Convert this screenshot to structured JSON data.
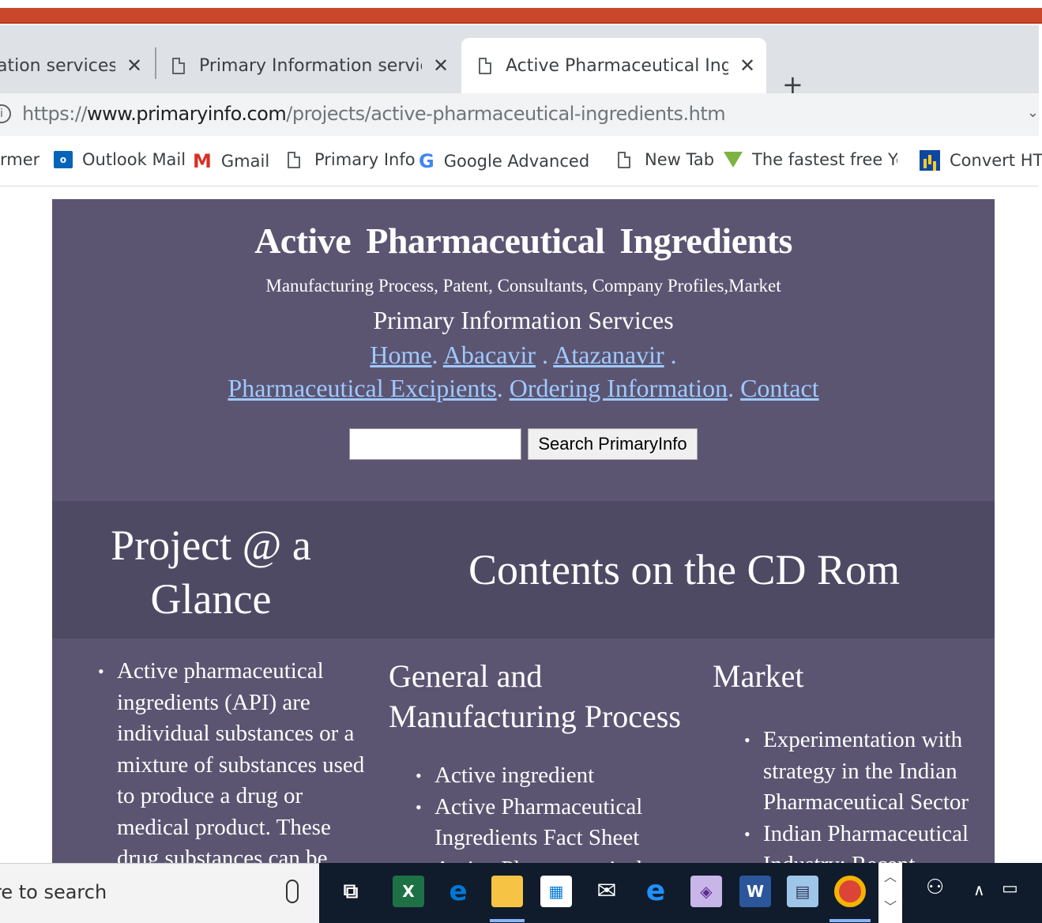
{
  "browser": {
    "tabs": [
      {
        "title": "ation services:Trad",
        "active": false
      },
      {
        "title": "Primary Information services:Trad",
        "active": false
      },
      {
        "title": "Active Pharmaceutical  Ingredien",
        "active": true
      }
    ],
    "close_glyph": "✕",
    "new_tab_glyph": "+",
    "url_scheme": "https://",
    "url_host": "www.primaryinfo.com",
    "url_path": "/projects/active-pharmaceutical-ingredients.htm",
    "bookmarks": [
      {
        "label": "rmer",
        "icon": "none"
      },
      {
        "label": "Outlook Mail",
        "icon": "outlook-icon"
      },
      {
        "label": "Gmail",
        "icon": "gmail-icon"
      },
      {
        "label": "Primary Info",
        "icon": "page-icon"
      },
      {
        "label": "Google Advanced Se",
        "icon": "google-icon"
      },
      {
        "label": "New Tab",
        "icon": "page-icon"
      },
      {
        "label": "The fastest free YouT",
        "icon": "download-arrow-icon"
      },
      {
        "label": "Convert HTM",
        "icon": "chart-icon"
      }
    ]
  },
  "site": {
    "title": "Active Pharmaceutical  Ingredients",
    "subtitle": "Manufacturing Process, Patent, Consultants, Company Profiles,Market",
    "brand": "Primary Information Services",
    "nav": {
      "home": "Home",
      "abacavir": "Abacavir",
      "atazanavir": "Atazanavir",
      "excipients": "Pharmaceutical Excipients",
      "ordering": "Ordering Information",
      "contact": "Contact"
    },
    "search_button": "Search PrimaryInfo",
    "search_value": "",
    "band_left": "Project @ a Glance",
    "band_right": "Contents on the CD Rom",
    "col1_items": [
      "Active pharmaceutical ingredients (API) are individual substances or a mixture of substances used to produce a drug or medical product. These drug substances can be"
    ],
    "col2_heading": "General  and Manufacturing Process",
    "col2_items": [
      "Active ingredient",
      "Active Pharmaceutical Ingredients Fact Sheet",
      "Active Pharmaceutical"
    ],
    "col3_heading": "Market",
    "col3_items": [
      "Experimentation with strategy in the Indian Pharmaceutical Sector",
      "Indian Pharmaceutical Industry: Recent"
    ]
  },
  "taskbar": {
    "search_text": "re to search",
    "apps": [
      "task-view-icon",
      "excel-icon",
      "edge-icon",
      "file-explorer-icon",
      "store-icon",
      "mail-icon",
      "ie-icon",
      "visual-studio-icon",
      "word-icon",
      "notepad-icon",
      "chrome-icon"
    ],
    "colors": {
      "excel": "#1e7145",
      "edge": "#0078d7",
      "explorer": "#f6c344",
      "word": "#2b579a",
      "chrome": "#db4437"
    }
  }
}
